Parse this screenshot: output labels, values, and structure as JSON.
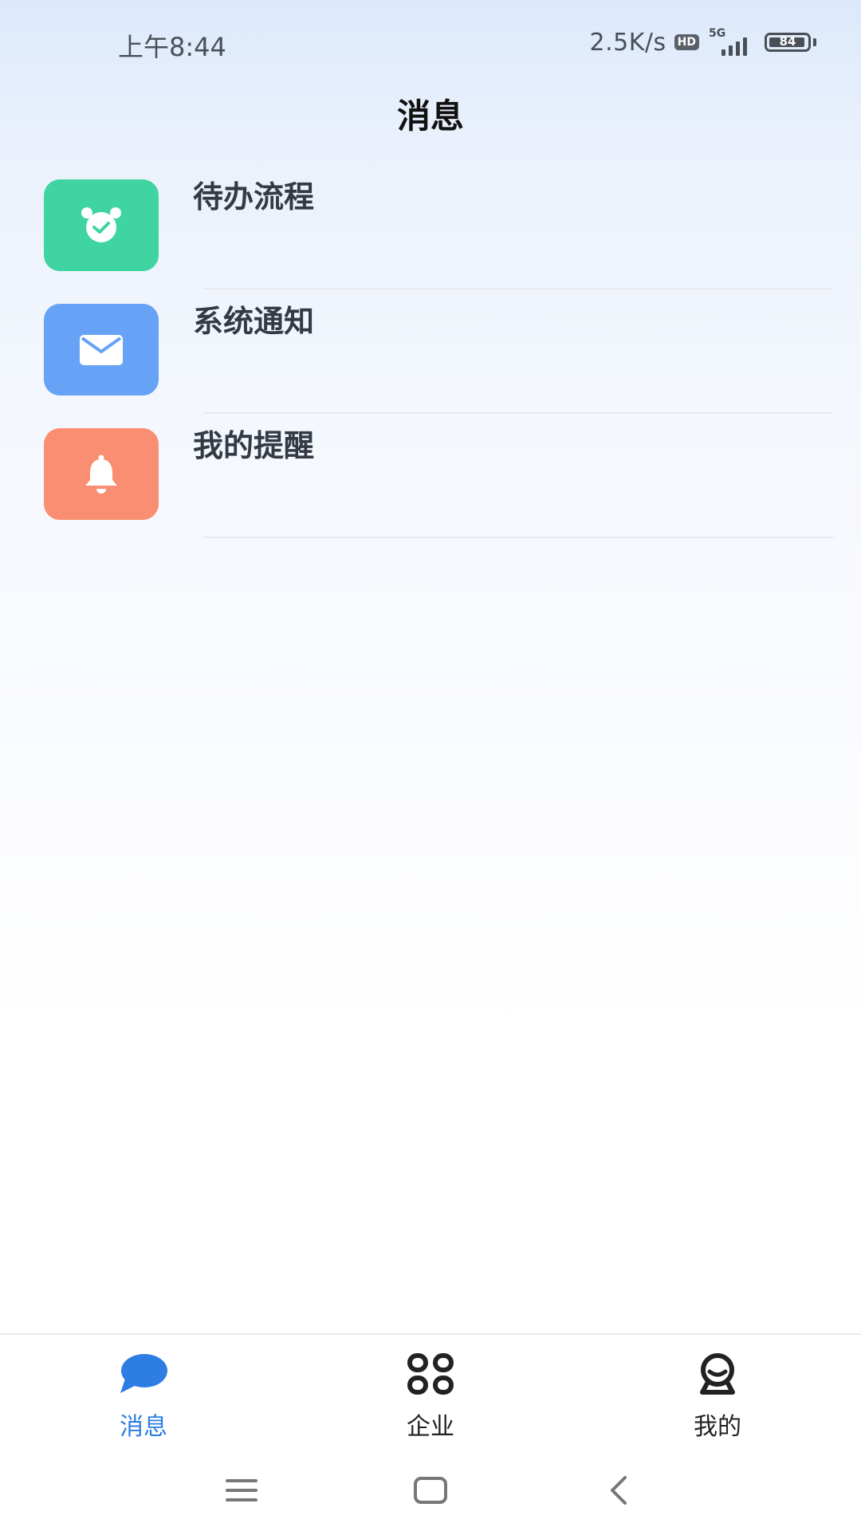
{
  "status_bar": {
    "time": "上午8:44",
    "net_speed": "2.5K/s",
    "hd": "HD",
    "network": "5G",
    "battery": "84"
  },
  "header": {
    "title": "消息"
  },
  "messages": [
    {
      "label": "待办流程",
      "icon": "alarm-clock-icon",
      "color": "#3fd4a2"
    },
    {
      "label": "系统通知",
      "icon": "mail-icon",
      "color": "#66a2f5"
    },
    {
      "label": "我的提醒",
      "icon": "bell-icon",
      "color": "#fa8e72"
    }
  ],
  "tabs": [
    {
      "label": "消息",
      "icon": "chat-bubble-icon",
      "active": true
    },
    {
      "label": "企业",
      "icon": "apps-grid-icon",
      "active": false
    },
    {
      "label": "我的",
      "icon": "profile-icon",
      "active": false
    }
  ],
  "nav": [
    "menu-icon",
    "home-icon",
    "back-icon"
  ],
  "colors": {
    "active": "#2e7de3",
    "text": "#333a44"
  }
}
